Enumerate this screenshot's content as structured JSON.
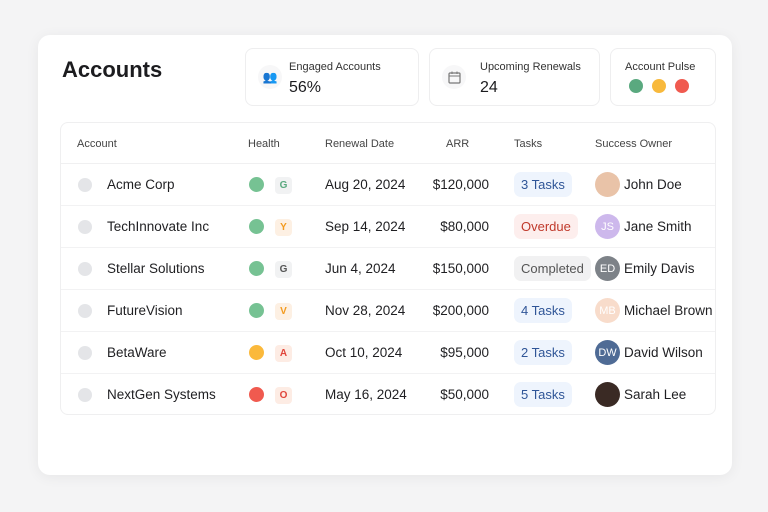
{
  "title": "Accounts",
  "stats": [
    {
      "label": "Engaged Accounts",
      "value": "56%",
      "icon": "users-icon"
    },
    {
      "label": "Upcoming Renewals",
      "value": "24",
      "icon": "calendar-icon"
    }
  ],
  "pulse": {
    "label": "Account Pulse",
    "colors": [
      "#5aa97f",
      "#f8b93c",
      "#f05a4f"
    ]
  },
  "columns": [
    "Account",
    "Health",
    "Renewal Date",
    "ARR",
    "Tasks",
    "Success Owner"
  ],
  "rows": [
    {
      "account": "Acme Corp",
      "health_color": "#76c293",
      "badge": "G",
      "badge_color": "#5aa97f",
      "badge_bg": "#f1f2f3",
      "date": "Aug 20, 2024",
      "arr": "$120,000",
      "tasks": "3 Tasks",
      "task_kind": "tasks",
      "owner": "John Doe",
      "initials": "",
      "avatar_bg": "#e9c3a8"
    },
    {
      "account": "TechInnovate Inc",
      "health_color": "#76c293",
      "badge": "Y",
      "badge_color": "#f39a1e",
      "badge_bg": "#fdf0e3",
      "date": "Sep 14, 2024",
      "arr": "$80,000",
      "tasks": "Overdue",
      "task_kind": "overdue",
      "owner": "Jane Smith",
      "initials": "JS",
      "avatar_bg": "#cdb8ec"
    },
    {
      "account": "Stellar Solutions",
      "health_color": "#76c293",
      "badge": "G",
      "badge_color": "#555",
      "badge_bg": "#f1f2f3",
      "date": "Jun 4, 2024",
      "arr": "$150,000",
      "tasks": "Completed",
      "task_kind": "completed",
      "owner": "Emily Davis",
      "initials": "ED",
      "avatar_bg": "#7d8288"
    },
    {
      "account": "FutureVision",
      "health_color": "#76c293",
      "badge": "V",
      "badge_color": "#f39a1e",
      "badge_bg": "#fdf0e3",
      "date": "Nov 28, 2024",
      "arr": "$200,000",
      "tasks": "4 Tasks",
      "task_kind": "tasks",
      "owner": "Michael Brown",
      "initials": "MB",
      "avatar_bg": "#f8dccb"
    },
    {
      "account": "BetaWare",
      "health_color": "#fbb93b",
      "badge": "A",
      "badge_color": "#e0453a",
      "badge_bg": "#fdece4",
      "date": "Oct 10, 2024",
      "arr": "$95,000",
      "tasks": "2 Tasks",
      "task_kind": "tasks",
      "owner": "David Wilson",
      "initials": "DW",
      "avatar_bg": "#4f6b95"
    },
    {
      "account": "NextGen Systems",
      "health_color": "#f05a4f",
      "badge": "O",
      "badge_color": "#e0453a",
      "badge_bg": "#fdece4",
      "date": "May 16, 2024",
      "arr": "$50,000",
      "tasks": "5 Tasks",
      "task_kind": "tasks",
      "owner": "Sarah Lee",
      "initials": "",
      "avatar_bg": "#3a2a24"
    }
  ]
}
